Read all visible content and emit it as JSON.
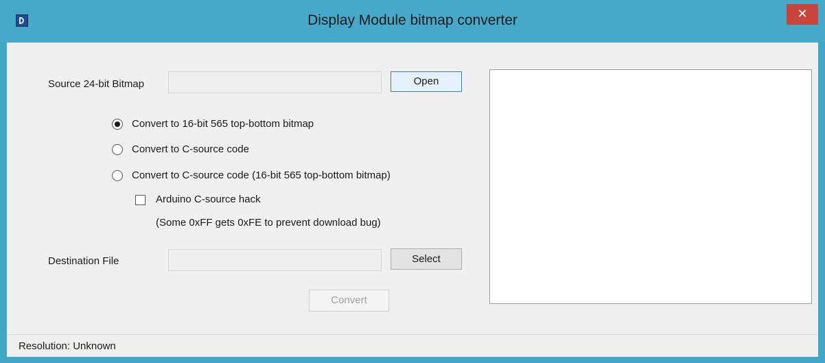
{
  "window": {
    "title": "Display Module bitmap converter",
    "close_glyph": "✕",
    "colors": {
      "frame": "#46a9c9",
      "close": "#c7453b"
    }
  },
  "source": {
    "label": "Source 24-bit Bitmap",
    "value": "",
    "open_label": "Open"
  },
  "options": [
    {
      "label": "Convert to 16-bit 565 top-bottom  bitmap",
      "selected": true
    },
    {
      "label": "Convert to C-source code",
      "selected": false
    },
    {
      "label": "Convert to C-source code (16-bit 565 top-bottom bitmap)",
      "selected": false
    }
  ],
  "arduino": {
    "label": "Arduino C-source hack",
    "checked": false,
    "note": "(Some 0xFF gets 0xFE to prevent download bug)"
  },
  "destination": {
    "label": "Destination File",
    "value": "",
    "select_label": "Select"
  },
  "convert_label": "Convert",
  "status": {
    "text": "Resolution: Unknown"
  }
}
